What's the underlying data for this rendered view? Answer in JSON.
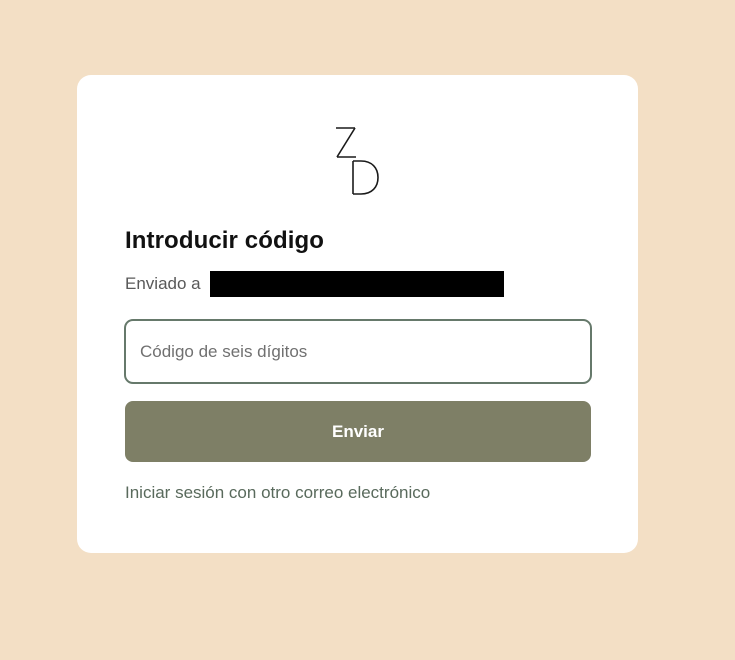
{
  "logo": {
    "text": "ZD",
    "icon": "zd-monogram-logo"
  },
  "form": {
    "title": "Introducir código",
    "sent_label": "Enviado a",
    "code_placeholder": "Código de seis dígitos",
    "code_value": "",
    "submit_label": "Enviar",
    "alt_signin_link": "Iniciar sesión con otro correo electrónico"
  },
  "colors": {
    "background": "#f3dfc5",
    "card": "#ffffff",
    "button": "#7e7f66",
    "input_border": "#66796b",
    "link": "#596a5c"
  }
}
